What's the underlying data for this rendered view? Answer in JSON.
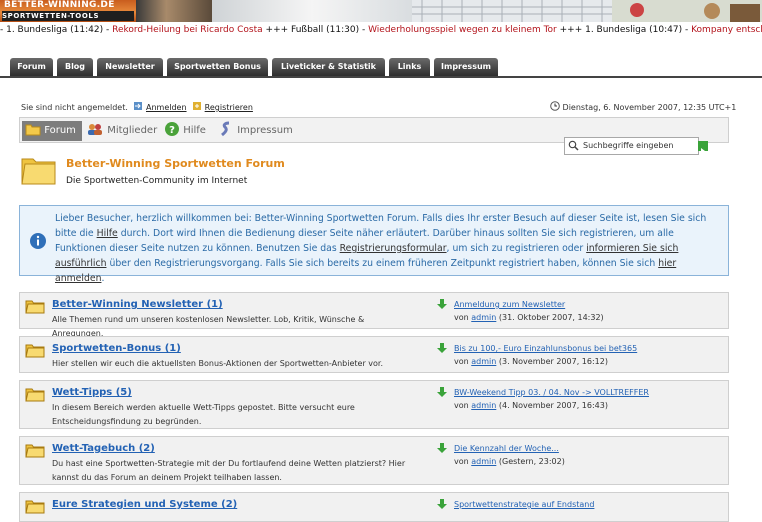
{
  "header": {
    "logo_line1": "BETTER-WINNING.DE",
    "logo_line2": "SPORTWETTEN-TOOLS"
  },
  "ticker": [
    {
      "text": "- 1. Bundesliga (11:42) - ",
      "style": "b"
    },
    {
      "text": "Rekord-Heilung bei Ricardo Costa",
      "style": "r"
    },
    {
      "text": " +++ Fußball (11:30) - ",
      "style": "b"
    },
    {
      "text": "Wiederholungsspiel wegen zu kleinem Tor",
      "style": "r"
    },
    {
      "text": " +++ 1. Bundesliga (10:47) - ",
      "style": "b"
    },
    {
      "text": "Kompany entscheidet",
      "style": "r"
    }
  ],
  "nav": {
    "tabs": [
      "Forum",
      "Blog",
      "Newsletter",
      "Sportwetten Bonus",
      "Liveticker & Statistik",
      "Links",
      "Impressum"
    ]
  },
  "status": {
    "not_logged_in": "Sie sind nicht angemeldet.",
    "login": "Anmelden",
    "register": "Registrieren",
    "datetime": "Dienstag, 6. November 2007, 12:35 UTC+1"
  },
  "toolbar": {
    "items": [
      "Forum",
      "Mitglieder",
      "Hilfe",
      "Impressum"
    ],
    "active": 0
  },
  "search": {
    "placeholder": "Suchbegriffe eingeben"
  },
  "forum_header": {
    "title": "Better-Winning Sportwetten Forum",
    "subtitle": "Die Sportwetten-Community im Internet"
  },
  "notice": {
    "segments": [
      {
        "text": "Lieber Besucher, herzlich willkommen bei: Better-Winning Sportwetten Forum. Falls dies Ihr erster Besuch auf dieser Seite ist, lesen Sie sich bitte die ",
        "link": false
      },
      {
        "text": "Hilfe",
        "link": true
      },
      {
        "text": " durch. Dort wird Ihnen die Bedienung dieser Seite näher erläutert. Darüber hinaus sollten Sie sich registrieren, um alle Funktionen dieser Seite nutzen zu können. Benutzen Sie das ",
        "link": false
      },
      {
        "text": "Registrierungsformular",
        "link": true
      },
      {
        "text": ", um sich zu registrieren oder ",
        "link": false
      },
      {
        "text": "informieren Sie sich ausführlich",
        "link": true
      },
      {
        "text": " über den Registrierungsvorgang. Falls Sie sich bereits zu einem früheren Zeitpunkt registriert haben, können Sie sich ",
        "link": false
      },
      {
        "text": "hier anmelden",
        "link": true
      },
      {
        "text": ".",
        "link": false
      }
    ]
  },
  "forums": [
    {
      "title": "Better-Winning Newsletter (1)",
      "description": "Alle Themen rund um unseren kostenlosen Newsletter. Lob, Kritik, Wünsche & Anregungen.",
      "last_post": "Anmeldung zum Newsletter",
      "by": "von",
      "author": "admin",
      "date": "(31. Oktober 2007, 14:32)"
    },
    {
      "title": "Sportwetten-Bonus (1)",
      "description": "Hier stellen wir euch die aktuellsten Bonus-Aktionen der Sportwetten-Anbieter vor.",
      "last_post": "Bis zu 100,- Euro Einzahlunsbonus bei bet365",
      "by": "von",
      "author": "admin",
      "date": "(3. November 2007, 16:12)"
    },
    {
      "title": "Wett-Tipps (5)",
      "description": "In diesem Bereich werden aktuelle Wett-Tipps gepostet. Bitte versucht eure Entscheidungsfindung zu begründen.",
      "last_post": "BW-Weekend Tipp 03. / 04. Nov -> VOLLTREFFER",
      "by": "von",
      "author": "admin",
      "date": "(4. November 2007, 16:43)"
    },
    {
      "title": "Wett-Tagebuch (2)",
      "description": "Du hast eine Sportwetten-Strategie mit der Du fortlaufend deine Wetten platzierst? Hier kannst du das Forum an deinem Projekt teilhaben lassen.",
      "last_post": "Die Kennzahl der Woche...",
      "by": "von",
      "author": "admin",
      "date": "(Gestern, 23:02)"
    },
    {
      "title": "Eure Strategien und Systeme (2)",
      "description": "",
      "last_post": "Sportwettenstrategie auf Endstand",
      "by": "",
      "author": "",
      "date": ""
    }
  ]
}
